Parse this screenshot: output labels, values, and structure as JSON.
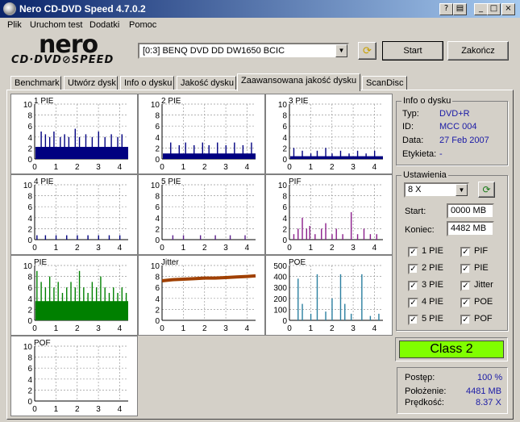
{
  "window": {
    "title": "Nero CD-DVD Speed 4.7.0.2"
  },
  "menu": [
    "Plik",
    "Uruchom test",
    "Dodatki",
    "Pomoc"
  ],
  "logo": {
    "brand": "nero",
    "sub": "CD·DVD⊘SPEED"
  },
  "drive": {
    "selected": "[0:3]   BENQ DVD DD DW1650 BCIC"
  },
  "buttons": {
    "start": "Start",
    "close": "Zakończ"
  },
  "tabs": [
    "Benchmark",
    "Utwórz dysk",
    "Info o dysku",
    "Jakość dysku",
    "Zaawansowana jakość dysku",
    "ScanDisc"
  ],
  "active_tab": "Zaawansowana jakość dysku",
  "disc_info": {
    "title": "Info o dysku",
    "type_label": "Typ:",
    "type_value": "DVD+R",
    "id_label": "ID:",
    "id_value": "MCC 004",
    "date_label": "Data:",
    "date_value": "27 Feb 2007",
    "label_label": "Etykieta:",
    "label_value": "-"
  },
  "settings": {
    "title": "Ustawienia",
    "speed": "8 X",
    "start_label": "Start:",
    "start_value": "0000 MB",
    "end_label": "Koniec:",
    "end_value": "4482 MB",
    "checkboxes": [
      {
        "label": "1 PIE",
        "checked": true
      },
      {
        "label": "PIF",
        "checked": true
      },
      {
        "label": "2 PIE",
        "checked": true
      },
      {
        "label": "PIE",
        "checked": true
      },
      {
        "label": "3 PIE",
        "checked": true
      },
      {
        "label": "Jitter",
        "checked": true
      },
      {
        "label": "4 PIE",
        "checked": true
      },
      {
        "label": "POE",
        "checked": true
      },
      {
        "label": "5 PIE",
        "checked": true
      },
      {
        "label": "POF",
        "checked": true
      }
    ]
  },
  "result": {
    "class": "Class 2"
  },
  "stats": {
    "progress_label": "Postęp:",
    "progress_value": "100 %",
    "position_label": "Położenie:",
    "position_value": "4481 MB",
    "speed_label": "Prędkość:",
    "speed_value": "8.37 X"
  },
  "chart_data": [
    {
      "type": "bar",
      "title": "1 PIE",
      "color": "#000080",
      "ylim": [
        0,
        10
      ],
      "xlim": [
        0,
        4.4
      ],
      "yticks": [
        0,
        2,
        4,
        6,
        8,
        10
      ],
      "xticks": [
        0,
        1,
        2,
        3,
        4
      ],
      "baseline": 2.2,
      "spikes": [
        [
          0.3,
          5
        ],
        [
          0.5,
          4.5
        ],
        [
          0.7,
          4
        ],
        [
          0.9,
          5
        ],
        [
          1.2,
          4
        ],
        [
          1.4,
          4.5
        ],
        [
          1.6,
          4
        ],
        [
          1.9,
          5.5
        ],
        [
          2.1,
          4
        ],
        [
          2.4,
          4.5
        ],
        [
          2.7,
          4
        ],
        [
          3.0,
          5
        ],
        [
          3.3,
          4
        ],
        [
          3.6,
          4.5
        ],
        [
          3.9,
          4
        ],
        [
          4.1,
          4.5
        ]
      ]
    },
    {
      "type": "bar",
      "title": "2 PIE",
      "color": "#000080",
      "ylim": [
        0,
        10
      ],
      "xlim": [
        0,
        4.4
      ],
      "yticks": [
        0,
        2,
        4,
        6,
        8,
        10
      ],
      "xticks": [
        0,
        1,
        2,
        3,
        4
      ],
      "baseline": 1.0,
      "spikes": [
        [
          0.4,
          3
        ],
        [
          0.8,
          2.5
        ],
        [
          1.1,
          3
        ],
        [
          1.5,
          2.5
        ],
        [
          1.9,
          3
        ],
        [
          2.2,
          2.5
        ],
        [
          2.6,
          3
        ],
        [
          3.0,
          2.5
        ],
        [
          3.4,
          3
        ],
        [
          3.8,
          2.5
        ],
        [
          4.2,
          3
        ]
      ]
    },
    {
      "type": "bar",
      "title": "3 PIE",
      "color": "#000080",
      "ylim": [
        0,
        10
      ],
      "xlim": [
        0,
        4.4
      ],
      "yticks": [
        0,
        2,
        4,
        6,
        8,
        10
      ],
      "xticks": [
        0,
        1,
        2,
        3,
        4
      ],
      "baseline": 0.5,
      "spikes": [
        [
          0.2,
          2
        ],
        [
          0.6,
          1.5
        ],
        [
          1.0,
          1
        ],
        [
          1.3,
          1.5
        ],
        [
          1.7,
          2
        ],
        [
          2.0,
          1
        ],
        [
          2.4,
          1.5
        ],
        [
          2.8,
          1
        ],
        [
          3.2,
          1.5
        ],
        [
          3.6,
          1
        ],
        [
          4.0,
          1.5
        ]
      ]
    },
    {
      "type": "bar",
      "title": "4 PIE",
      "color": "#000080",
      "ylim": [
        0,
        10
      ],
      "xlim": [
        0,
        4.4
      ],
      "yticks": [
        0,
        2,
        4,
        6,
        8,
        10
      ],
      "xticks": [
        0,
        1,
        2,
        3,
        4
      ],
      "baseline": 0,
      "spikes": [
        [
          0.1,
          0.8
        ],
        [
          0.5,
          0.8
        ],
        [
          1.0,
          0.8
        ],
        [
          1.5,
          0.8
        ],
        [
          2.0,
          0.8
        ],
        [
          2.5,
          0.8
        ],
        [
          3.0,
          0.8
        ],
        [
          3.5,
          0.8
        ],
        [
          4.0,
          0.8
        ]
      ]
    },
    {
      "type": "bar",
      "title": "5 PIE",
      "color": "#5b1e8b",
      "ylim": [
        0,
        10
      ],
      "xlim": [
        0,
        4.4
      ],
      "yticks": [
        0,
        2,
        4,
        6,
        8,
        10
      ],
      "xticks": [
        0,
        1,
        2,
        3,
        4
      ],
      "baseline": 0,
      "spikes": [
        [
          0.5,
          0.8
        ],
        [
          1.0,
          0.8
        ],
        [
          1.8,
          0.8
        ],
        [
          2.5,
          0.8
        ],
        [
          3.2,
          0.8
        ],
        [
          3.9,
          0.8
        ]
      ]
    },
    {
      "type": "bar",
      "title": "PIF",
      "color": "#8b1e8b",
      "ylim": [
        0,
        10
      ],
      "xlim": [
        0,
        4.4
      ],
      "yticks": [
        0,
        2,
        4,
        6,
        8,
        10
      ],
      "xticks": [
        0,
        1,
        2,
        3,
        4
      ],
      "baseline": 0,
      "spikes": [
        [
          0.2,
          1
        ],
        [
          0.4,
          2
        ],
        [
          0.6,
          4
        ],
        [
          0.8,
          2
        ],
        [
          0.95,
          2.5
        ],
        [
          1.2,
          1
        ],
        [
          1.5,
          2
        ],
        [
          1.7,
          3
        ],
        [
          2.0,
          1
        ],
        [
          2.2,
          2
        ],
        [
          2.5,
          1
        ],
        [
          2.9,
          5
        ],
        [
          3.2,
          1
        ],
        [
          3.5,
          2
        ],
        [
          3.8,
          1
        ],
        [
          4.1,
          1
        ]
      ]
    },
    {
      "type": "bar",
      "title": "PIE",
      "color": "#008000",
      "ylim": [
        0,
        10
      ],
      "xlim": [
        0,
        4.4
      ],
      "yticks": [
        0,
        2,
        4,
        6,
        8,
        10
      ],
      "xticks": [
        0,
        1,
        2,
        3,
        4
      ],
      "baseline": 3.5,
      "spikes": [
        [
          0.1,
          9
        ],
        [
          0.3,
          7
        ],
        [
          0.5,
          6
        ],
        [
          0.7,
          8
        ],
        [
          0.9,
          6
        ],
        [
          1.1,
          7
        ],
        [
          1.3,
          5
        ],
        [
          1.5,
          6
        ],
        [
          1.7,
          7
        ],
        [
          1.9,
          6
        ],
        [
          2.1,
          9
        ],
        [
          2.3,
          6
        ],
        [
          2.5,
          5
        ],
        [
          2.7,
          7
        ],
        [
          2.9,
          6
        ],
        [
          3.1,
          8
        ],
        [
          3.3,
          6
        ],
        [
          3.5,
          5
        ],
        [
          3.7,
          6
        ],
        [
          3.9,
          5
        ],
        [
          4.1,
          6
        ],
        [
          4.3,
          5
        ]
      ]
    },
    {
      "type": "line",
      "title": "Jitter",
      "color": "#a04000",
      "ylim": [
        0,
        10
      ],
      "xlim": [
        0,
        4.4
      ],
      "yticks": [
        0,
        2,
        4,
        6,
        8,
        10
      ],
      "xticks": [
        0,
        1,
        2,
        3,
        4
      ],
      "x": [
        0,
        0.5,
        1,
        1.5,
        2,
        2.5,
        3,
        3.5,
        4,
        4.4
      ],
      "y": [
        7.2,
        7.4,
        7.5,
        7.6,
        7.7,
        7.7,
        7.8,
        7.9,
        8.0,
        8.1
      ]
    },
    {
      "type": "bar",
      "title": "POE",
      "color": "#2b7fa0",
      "ylim": [
        0,
        500
      ],
      "xlim": [
        0,
        4.4
      ],
      "yticks": [
        0,
        100,
        200,
        300,
        400,
        500
      ],
      "xticks": [
        0,
        1,
        2,
        3,
        4
      ],
      "baseline": 0,
      "spikes": [
        [
          0.4,
          380
        ],
        [
          0.6,
          150
        ],
        [
          1.0,
          60
        ],
        [
          1.3,
          420
        ],
        [
          1.7,
          80
        ],
        [
          2.0,
          200
        ],
        [
          2.4,
          420
        ],
        [
          2.6,
          150
        ],
        [
          2.9,
          60
        ],
        [
          3.4,
          420
        ],
        [
          3.8,
          40
        ],
        [
          4.2,
          60
        ]
      ]
    },
    {
      "type": "bar",
      "title": "POF",
      "color": "#000080",
      "ylim": [
        0,
        10
      ],
      "xlim": [
        0,
        4.4
      ],
      "yticks": [
        0,
        2,
        4,
        6,
        8,
        10
      ],
      "xticks": [
        0,
        1,
        2,
        3,
        4
      ],
      "baseline": 0,
      "spikes": []
    }
  ]
}
